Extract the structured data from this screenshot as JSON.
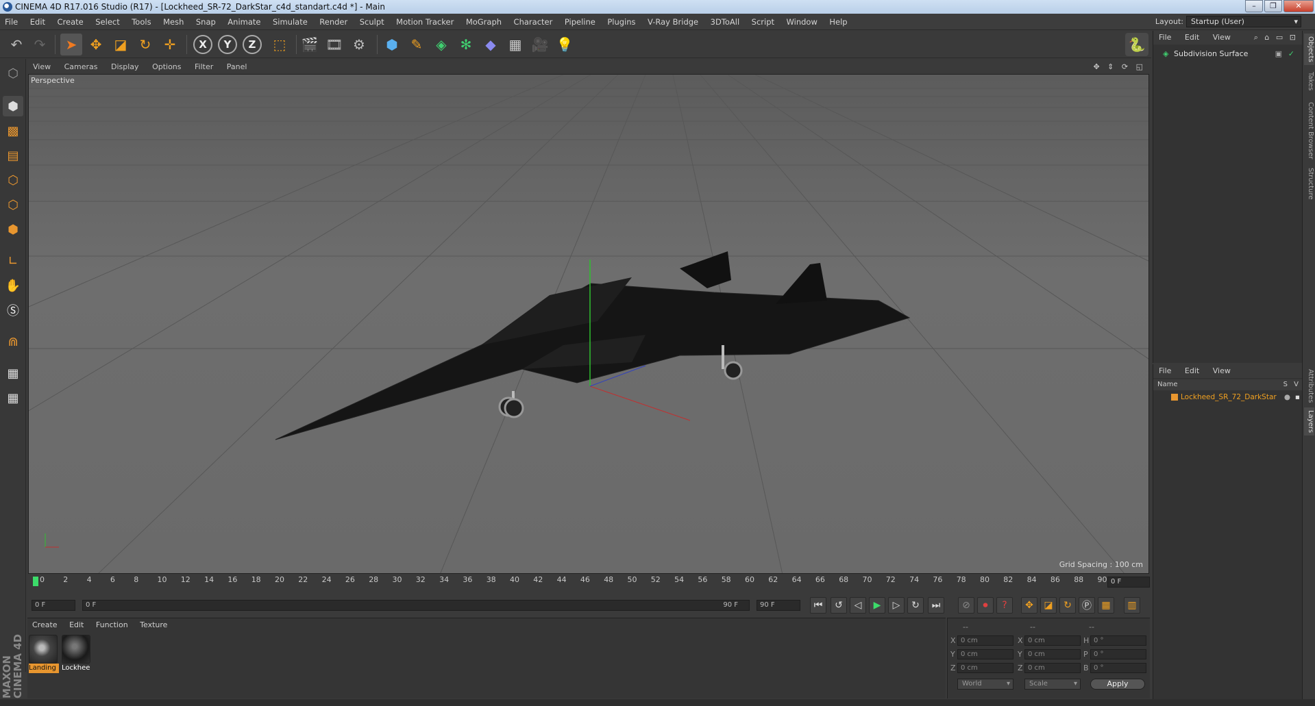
{
  "window": {
    "title": "CINEMA 4D R17.016 Studio (R17) - [Lockheed_SR-72_DarkStar_c4d_standart.c4d *] - Main",
    "controls": [
      "–",
      "❐",
      "✕"
    ]
  },
  "menu": [
    "File",
    "Edit",
    "Create",
    "Select",
    "Tools",
    "Mesh",
    "Snap",
    "Animate",
    "Simulate",
    "Render",
    "Sculpt",
    "Motion Tracker",
    "MoGraph",
    "Character",
    "Pipeline",
    "Plugins",
    "V-Ray Bridge",
    "3DToAll",
    "Script",
    "Window",
    "Help"
  ],
  "layout": {
    "label": "Layout:",
    "value": "Startup (User)"
  },
  "toolbar": {
    "icons": [
      "undo-icon",
      "redo-icon",
      "select-arrow-icon",
      "move-icon",
      "scale-icon",
      "rotate-icon",
      "move-plus-icon",
      "x-axis-icon",
      "y-axis-icon",
      "z-axis-icon",
      "coordinate-system-icon",
      "render-view-icon",
      "render-picture-viewer-icon",
      "render-settings-icon",
      "cube-icon",
      "pen-spline-icon",
      "subdivision-icon",
      "cloner-icon",
      "deformer-icon",
      "floor-icon",
      "camera-icon",
      "light-icon",
      "python-icon"
    ],
    "axis_labels": [
      "X",
      "Y",
      "Z"
    ]
  },
  "viewport": {
    "menu": [
      "View",
      "Cameras",
      "Display",
      "Options",
      "Filter",
      "Panel"
    ],
    "label": "Perspective",
    "grid_spacing": "Grid Spacing : 100 cm"
  },
  "timeline": {
    "ticks": [
      "0",
      "2",
      "4",
      "6",
      "8",
      "10",
      "12",
      "14",
      "16",
      "18",
      "20",
      "22",
      "24",
      "26",
      "28",
      "30",
      "32",
      "34",
      "36",
      "38",
      "40",
      "42",
      "44",
      "46",
      "48",
      "50",
      "52",
      "54",
      "56",
      "58",
      "60",
      "62",
      "64",
      "66",
      "68",
      "70",
      "72",
      "74",
      "76",
      "78",
      "80",
      "82",
      "84",
      "86",
      "88",
      "90"
    ],
    "current_frame": "0 F",
    "start_field": "0 F",
    "range_start": "0 F",
    "range_end": "90 F",
    "end_field": "90 F"
  },
  "materials": {
    "menu": [
      "Create",
      "Edit",
      "Function",
      "Texture"
    ],
    "items": [
      {
        "label": "Landing",
        "selected": true
      },
      {
        "label": "Lockhee",
        "selected": false
      }
    ]
  },
  "coords": {
    "header": [
      "--",
      "--",
      "--"
    ],
    "rows": [
      {
        "a": "X",
        "av": "0 cm",
        "b": "X",
        "bv": "0 cm",
        "c": "H",
        "cv": "0 °"
      },
      {
        "a": "Y",
        "av": "0 cm",
        "b": "Y",
        "bv": "0 cm",
        "c": "P",
        "cv": "0 °"
      },
      {
        "a": "Z",
        "av": "0 cm",
        "b": "Z",
        "bv": "0 cm",
        "c": "B",
        "cv": "0 °"
      }
    ],
    "mode_select": "World",
    "scale_select": "Scale",
    "apply": "Apply"
  },
  "objects": {
    "menu": [
      "File",
      "Edit",
      "View"
    ],
    "item": "Subdivision Surface"
  },
  "layers": {
    "menu": [
      "File",
      "Edit",
      "View"
    ],
    "columns": [
      "Name",
      "S",
      "V"
    ],
    "item": "Lockheed_SR_72_DarkStar"
  },
  "side_tabs_top": [
    "Objects",
    "Takes",
    "Content Browser",
    "Structure"
  ],
  "side_tabs_bottom": [
    "Attributes",
    "Layers"
  ],
  "colors": {
    "accent": "#e8962f",
    "layer_orange": "#f0a020",
    "viewport_bg": "#666666"
  }
}
